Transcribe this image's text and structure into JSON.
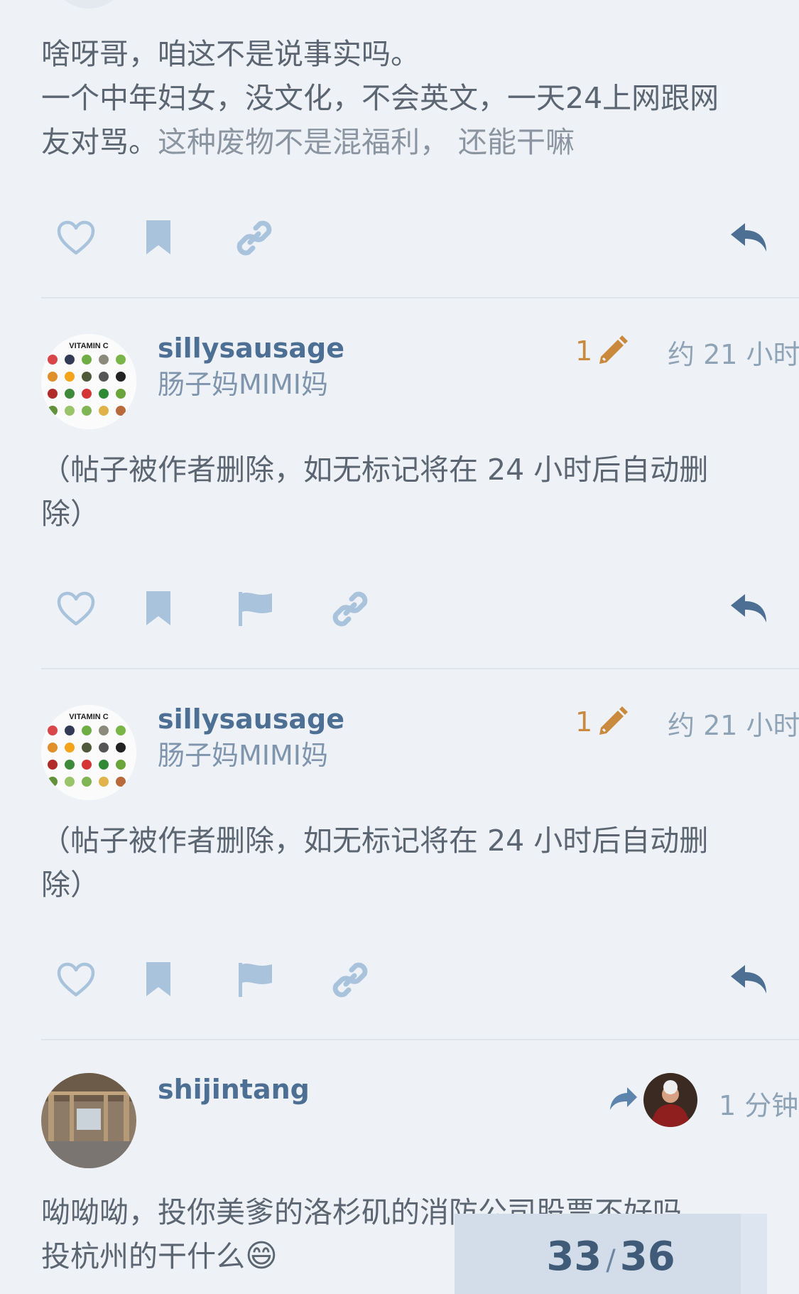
{
  "posts": [
    {
      "lines": [
        "啥呀哥，咱这不是说事实吗。",
        "一个中年妇女，没文化，不会英文，一天24上网跟网"
      ],
      "line3_a": "友对骂。",
      "line3_b": "这种废物不是混福利， 还能干嘛"
    },
    {
      "username": "sillysausage",
      "fullname": "肠子妈MIMI妈",
      "edit_count": "1",
      "time": "约 21 小时",
      "avatar_text": "VITAMIN C",
      "lines": [
        "（帖子被作者删除，如无标记将在 24 小时后自动删",
        "除）"
      ]
    },
    {
      "username": "sillysausage",
      "fullname": "肠子妈MIMI妈",
      "edit_count": "1",
      "time": "约 21 小时",
      "avatar_text": "VITAMIN C",
      "lines": [
        "（帖子被作者删除，如无标记将在 24 小时后自动删",
        "除）"
      ]
    },
    {
      "username": "shijintang",
      "time": "1 分钟",
      "lines": [
        "呦呦呦，投你美爹的洛杉矶的消防公司股票不好吗",
        "投杭州的干什么"
      ],
      "emoji": "😄"
    }
  ],
  "progress": {
    "current": "33",
    "separator": "/",
    "total": "36",
    "fraction": 0.917
  },
  "colors": {
    "background": "#eef2f7",
    "accent": "#4d6f94",
    "edit": "#c98a3e",
    "icon": "#a9c3dc"
  },
  "icons": [
    "heart-icon",
    "bookmark-icon",
    "flag-icon",
    "link-icon",
    "reply-icon",
    "pencil-icon",
    "share-arrow-icon"
  ]
}
